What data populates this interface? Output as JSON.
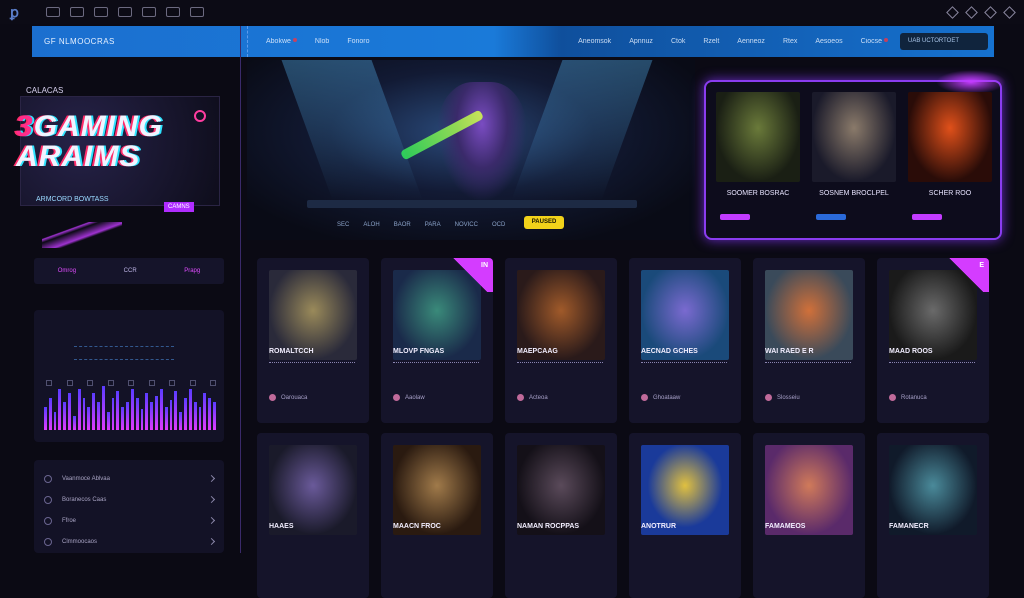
{
  "topbar": {
    "logo": "ꝑ",
    "icons": [
      "nav-icon-1",
      "nav-icon-2",
      "nav-icon-3",
      "nav-icon-4",
      "nav-icon-5",
      "nav-icon-6",
      "nav-icon-7"
    ],
    "right_icons": [
      "pin-icon",
      "bell-icon",
      "share-icon",
      "settings-icon"
    ]
  },
  "navbar": {
    "brand": "GF NLMOOCRAS",
    "items": [
      "Abokwe",
      "Nlob",
      "Fonoro",
      "Aneomsok",
      "Apnnuz",
      "Ctok",
      "Rzelt",
      "Aenneoz",
      "Rtex",
      "Aesoeos",
      "Ciocse"
    ],
    "search": "UAB UCTORTOET"
  },
  "sidebar": {
    "logo_small": "CALACAS",
    "logo_big_num": "3",
    "logo_big_1": "GAMING",
    "logo_big_2": "ARAIMS",
    "logo_sub": "ARMCORD BOWTASS",
    "logo_tag": "CAMNS",
    "filters": [
      "Omrog",
      "CCR",
      "Prapg"
    ],
    "menu": [
      "Vaanmoce Ablvaa",
      "Boranecos Caas",
      "Ffroe",
      "Clmmoocaos"
    ]
  },
  "banner": {
    "controls": [
      "SEC",
      "ALOH",
      "BAOR",
      "PARA",
      "NOVICC",
      "OCD"
    ],
    "play_label": "PAUSED"
  },
  "featured": [
    {
      "title": "SOOMER BOSRAC",
      "accent": "#c33cff"
    },
    {
      "title": "SOSNEM BROCLPEL",
      "accent": "#2a6ad9"
    },
    {
      "title": "SCHER ROO",
      "accent": "#c33cff"
    }
  ],
  "games": [
    {
      "title": "ROMALTCCH",
      "meta": "Oarouaca"
    },
    {
      "title": "MLOVP FNGAS",
      "meta": "Aaolaw"
    },
    {
      "title": "MAEPCAAG",
      "meta": "Acteoa"
    },
    {
      "title": "AECNAD GCHES",
      "meta": "Ghoataaw"
    },
    {
      "title": "WAI RAED E R",
      "meta": "Slosseiu"
    },
    {
      "title": "MAAD ROOS",
      "meta": "Rotanuca"
    },
    {
      "title": "HAAES",
      "meta": ""
    },
    {
      "title": "MAACN FROC",
      "meta": ""
    },
    {
      "title": "NAMAN ROCPPAS",
      "meta": ""
    },
    {
      "title": "ANOTRUR",
      "meta": ""
    },
    {
      "title": "FAMAMEOS",
      "meta": ""
    },
    {
      "title": "FAMANECR",
      "meta": ""
    }
  ],
  "badges": {
    "new_1": "IN",
    "new_2": "E"
  },
  "eq_levels": [
    0.5,
    0.7,
    0.4,
    0.9,
    0.6,
    0.8,
    0.3,
    0.9,
    0.7,
    0.5,
    0.8,
    0.6,
    0.95,
    0.4,
    0.7,
    0.85,
    0.5,
    0.6,
    0.9,
    0.7,
    0.45,
    0.8,
    0.6,
    0.75,
    0.9,
    0.5,
    0.65,
    0.85,
    0.4,
    0.7,
    0.9,
    0.6,
    0.5,
    0.8,
    0.7,
    0.6
  ],
  "colors": {
    "accent": "#c33cff",
    "brand": "#1b6fcf",
    "play": "#f2d21a"
  }
}
